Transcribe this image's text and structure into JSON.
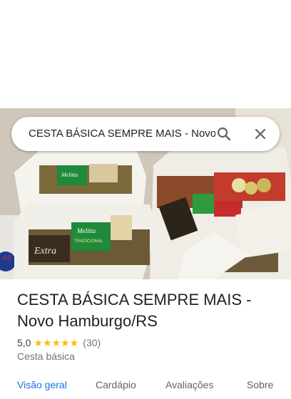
{
  "search": {
    "query": "CESTA BÁSICA SEMPRE MAIS - Novo Hamburgo/RS"
  },
  "place": {
    "name": "CESTA BÁSICA SEMPRE MAIS - Novo Hamburgo/RS",
    "rating": "5,0",
    "review_count": "(30)",
    "stars": 5,
    "category": "Cesta básica"
  },
  "tabs": [
    {
      "label": "Visão geral",
      "active": true
    },
    {
      "label": "Cardápio",
      "active": false
    },
    {
      "label": "Avaliações",
      "active": false
    },
    {
      "label": "Sobre",
      "active": false
    }
  ],
  "photo_labels": {
    "brand_green": "Melitta",
    "brand_green_sub": "TRADICIONAL",
    "brand_extra": "Extra"
  },
  "colors": {
    "accent": "#1a73e8",
    "star": "#fbbc04",
    "text_primary": "#202124",
    "text_secondary": "#70757a"
  }
}
